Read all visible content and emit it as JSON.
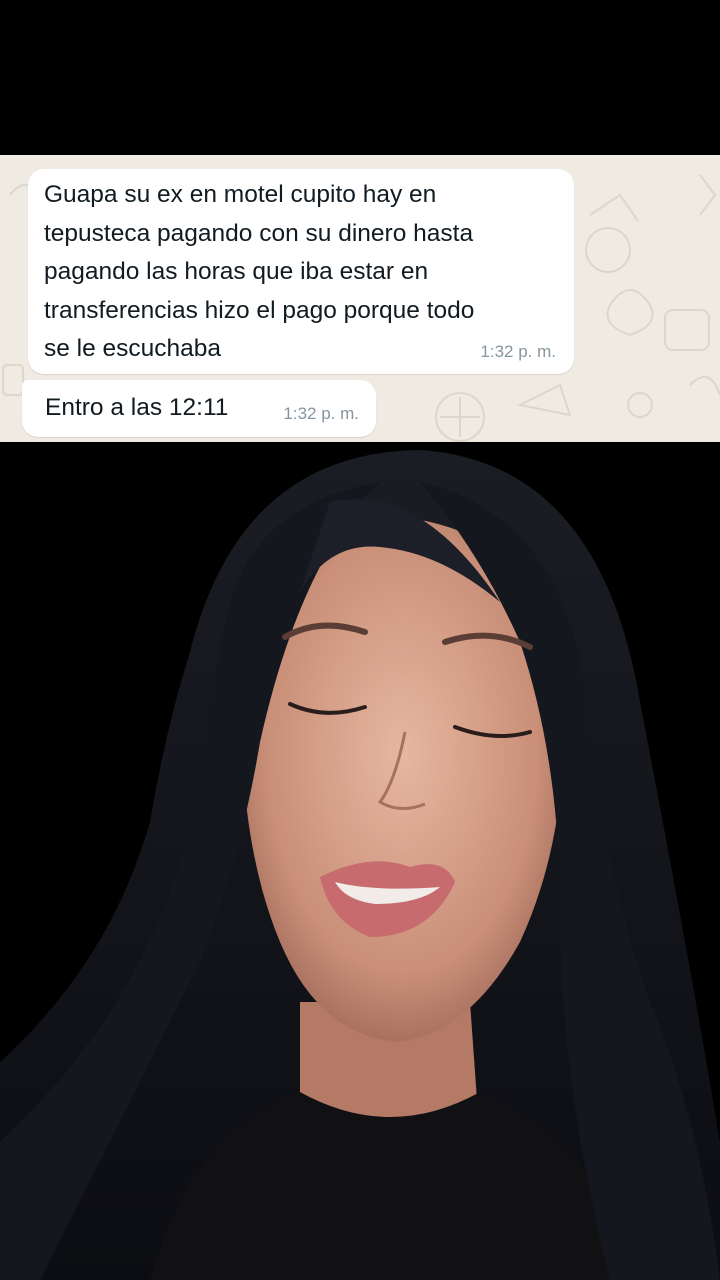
{
  "chat": {
    "messages": [
      {
        "text": "Guapa su ex en motel cupito hay en\ntepusteca pagando con su dinero hasta\npagando las horas que iba estar en\ntransferencias hizo el pago porque todo\nse le escuchaba",
        "time": "1:32 p. m."
      },
      {
        "text": "Entro a las 12:11",
        "time": "1:32 p. m."
      }
    ],
    "colors": {
      "wallpaper": "#efeae2",
      "bubble": "#ffffff",
      "text": "#111b21",
      "time": "#8696a0"
    }
  },
  "video": {
    "background_color": "#000000",
    "subject": "woman-with-long-black-hair-speaking"
  }
}
